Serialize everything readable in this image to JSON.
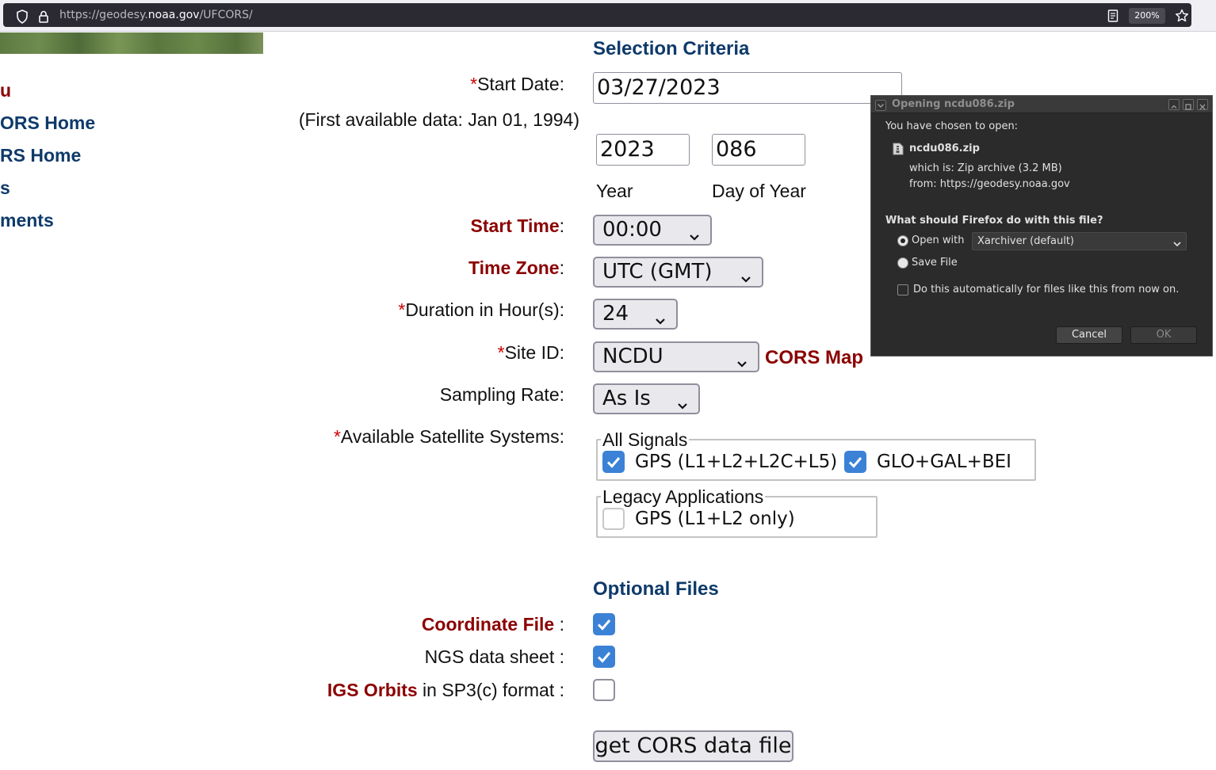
{
  "browser": {
    "url_prefix": "https://geodesy.",
    "url_host": "noaa.gov",
    "url_path": "/UFCORS/",
    "zoom": "200%"
  },
  "sidebar": {
    "items": [
      {
        "label": "u"
      },
      {
        "label": "ORS Home"
      },
      {
        "label": "RS Home"
      },
      {
        "label": "s"
      },
      {
        "label": "ments"
      }
    ]
  },
  "form": {
    "section_title": "Selection Criteria",
    "start_date": {
      "required": "*",
      "label": "Start Date:",
      "value": "03/27/2023",
      "note": "(First available data: Jan 01, 1994)"
    },
    "year": {
      "value": "2023",
      "label": "Year"
    },
    "day_of_year": {
      "value": "086",
      "label": "Day of Year"
    },
    "start_time": {
      "label": "Start Time",
      "colon": ":",
      "value": "00:00"
    },
    "time_zone": {
      "label": "Time Zone",
      "colon": ":",
      "value": "UTC (GMT)"
    },
    "duration": {
      "required": "*",
      "label": "Duration in Hour(s):",
      "value": "24"
    },
    "site_id": {
      "required": "*",
      "label": "Site ID:",
      "value": "NCDU",
      "map_link": "CORS Map"
    },
    "sampling_rate": {
      "label": "Sampling Rate:",
      "value": "As Is"
    },
    "satellites": {
      "required": "*",
      "label": "Available Satellite Systems:",
      "all_signals": {
        "legend": "All Signals",
        "options": [
          {
            "label": "GPS (L1+L2+L2C+L5)",
            "checked": true
          },
          {
            "label": "GLO+GAL+BEI",
            "checked": true
          }
        ]
      },
      "legacy": {
        "legend": "Legacy Applications",
        "options": [
          {
            "label": "GPS (L1+L2 only)",
            "checked": false
          }
        ]
      }
    },
    "optional_title": "Optional Files",
    "coordinate_file": {
      "label": "Coordinate File",
      "suffix": " :",
      "checked": true
    },
    "ngs_data_sheet": {
      "label": "NGS data sheet :",
      "checked": true
    },
    "igs_orbits": {
      "label": "IGS Orbits",
      "suffix": " in SP3(c) format :",
      "checked": false
    },
    "submit_label": "get CORS data file"
  },
  "dialog": {
    "title": "Opening ncdu086.zip",
    "chosen_text": "You have chosen to open:",
    "filename": "ncdu086.zip",
    "which_is_label": "which is:",
    "which_is_value": "Zip archive (3.2 MB)",
    "from_label": "from:",
    "from_value": "https://geodesy.noaa.gov",
    "question": "What should Firefox do with this file?",
    "open_with_label": "Open with",
    "open_with_app": "Xarchiver (default)",
    "save_file_label": "Save File",
    "auto_label": "Do this automatically for files like this from now on.",
    "cancel_label": "Cancel",
    "ok_label": "OK"
  },
  "colors": {
    "navy": "#0e3a6a",
    "dark_red": "#8b0000",
    "checkbox_blue": "#3b82d6",
    "dialog_bg": "#2b2b2b"
  }
}
